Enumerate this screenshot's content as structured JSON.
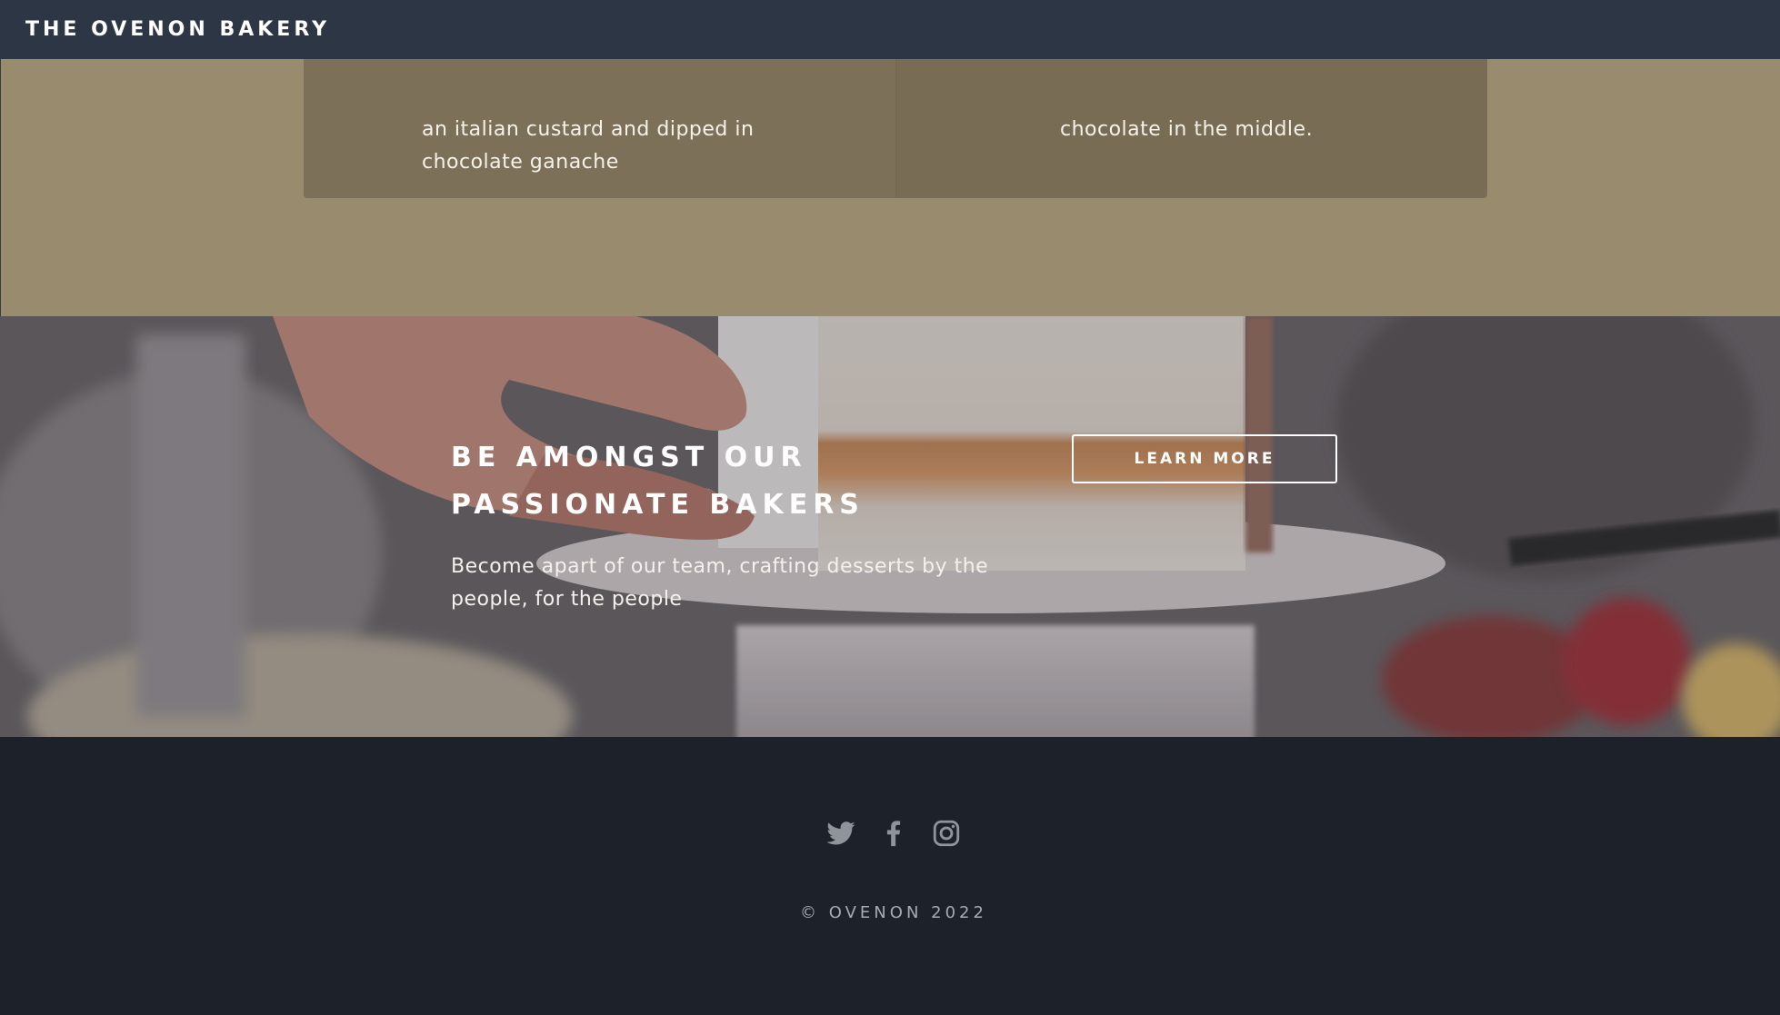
{
  "navbar": {
    "brand": "THE OVENON BAKERY"
  },
  "menu": {
    "cards": [
      {
        "text": "an italian custard and dipped in\nchocolate ganache"
      },
      {
        "text": "chocolate in the middle."
      }
    ]
  },
  "cta": {
    "title": "BE AMONGST OUR\nPASSIONATE BAKERS",
    "description": "Become apart of our team, crafting desserts by the\npeople, for the people",
    "button_label": "LEARN MORE"
  },
  "footer": {
    "social": [
      "twitter-icon",
      "facebook-icon",
      "instagram-icon"
    ],
    "copyright": "© OVENON 2022"
  },
  "colors": {
    "navbar": "#2c3644",
    "menu_section": "#998b6e",
    "menu_card": "#7c7058",
    "footer": "#1d222a",
    "icon": "#8f949a"
  }
}
